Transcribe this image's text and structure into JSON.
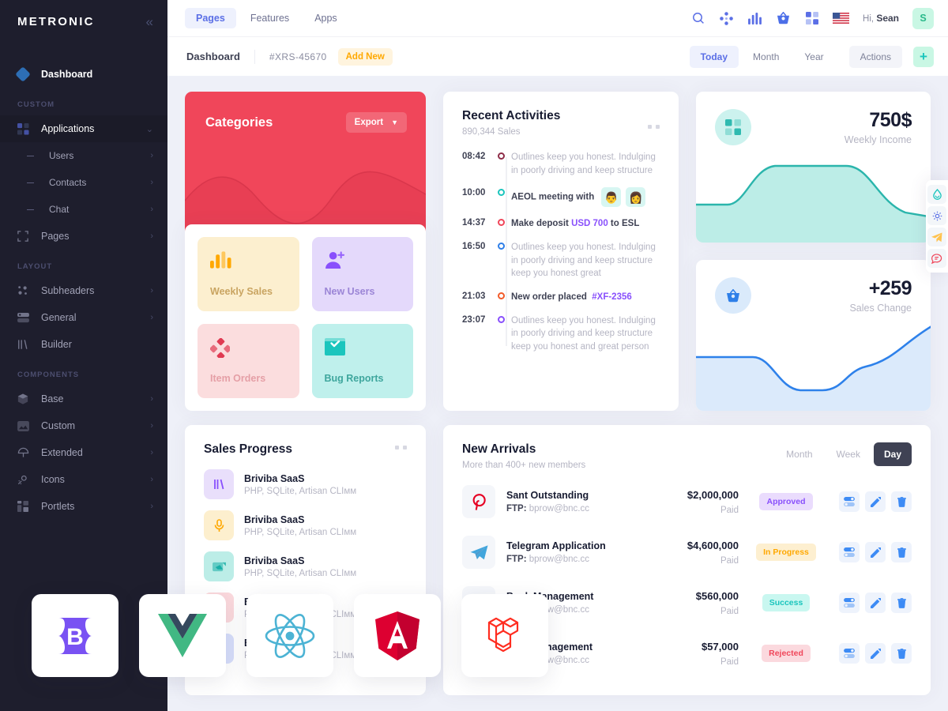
{
  "sidebar": {
    "brand": "METRONIC",
    "collapse_icon": "chevron-double-left-icon",
    "dashboard": {
      "label": "Dashboard",
      "icon": "diamond-icon"
    },
    "sections": [
      {
        "title": "CUSTOM",
        "items": [
          {
            "label": "Applications",
            "icon": "grid-icon",
            "arrow": "chevron-down",
            "active": true,
            "sub": false
          },
          {
            "label": "Users",
            "icon": "dash-icon",
            "arrow": "chevron-right",
            "sub": true
          },
          {
            "label": "Contacts",
            "icon": "dash-icon",
            "arrow": "chevron-right",
            "sub": true
          },
          {
            "label": "Chat",
            "icon": "dash-icon",
            "arrow": "chevron-right",
            "sub": true
          },
          {
            "label": "Pages",
            "icon": "frame-icon",
            "arrow": "chevron-right",
            "sub": false
          }
        ]
      },
      {
        "title": "LAYOUT",
        "items": [
          {
            "label": "Subheaders",
            "icon": "scatter-icon",
            "arrow": "chevron-right"
          },
          {
            "label": "General",
            "icon": "server-icon",
            "arrow": "chevron-right"
          },
          {
            "label": "Builder",
            "icon": "columns-icon",
            "arrow": ""
          }
        ]
      },
      {
        "title": "COMPONENTS",
        "items": [
          {
            "label": "Base",
            "icon": "box-icon",
            "arrow": "chevron-right"
          },
          {
            "label": "Custom",
            "icon": "image-icon",
            "arrow": "chevron-right"
          },
          {
            "label": "Extended",
            "icon": "umbrella-icon",
            "arrow": "chevron-right"
          },
          {
            "label": "Icons",
            "icon": "sparkle-icon",
            "arrow": "chevron-right"
          },
          {
            "label": "Portlets",
            "icon": "layout-icon",
            "arrow": "chevron-right"
          }
        ]
      }
    ]
  },
  "topbar": {
    "tabs": [
      {
        "label": "Pages",
        "active": true
      },
      {
        "label": "Features",
        "active": false
      },
      {
        "label": "Apps",
        "active": false
      }
    ],
    "icons": [
      "search-icon",
      "nodes-icon",
      "bar-chart-icon",
      "basket-icon",
      "grid-icon",
      "flag-us-icon"
    ],
    "greeting_prefix": "Hi,",
    "user_name": "Sean",
    "avatar_initial": "S"
  },
  "subheader": {
    "title": "Dashboard",
    "code": "#XRS-45670",
    "add_new": "Add New",
    "filters": [
      {
        "label": "Today",
        "active": true
      },
      {
        "label": "Month",
        "active": false
      },
      {
        "label": "Year",
        "active": false
      }
    ],
    "actions_label": "Actions",
    "plus_icon": "plus-file-icon"
  },
  "categories": {
    "title": "Categories",
    "export_label": "Export",
    "export_icon": "chevron-down-icon",
    "accent": "#F0465A",
    "tiles": [
      {
        "label": "Weekly Sales",
        "bg": "#FCEFCF",
        "fg": "#D9A85B",
        "icon": "bar-chart-icon",
        "icon_color": "#FFA800"
      },
      {
        "label": "New Users",
        "bg": "#E4D9FB",
        "fg": "#9B85D6",
        "icon": "user-plus-icon",
        "icon_color": "#8950FC"
      },
      {
        "label": "Item Orders",
        "bg": "#FBDDDE",
        "fg": "#DE9FA4",
        "icon": "diamonds-icon",
        "icon_color": "#F0465A"
      },
      {
        "label": "Bug Reports",
        "bg": "#BFF0EC",
        "fg": "#3EA69D",
        "icon": "mail-check-icon",
        "icon_color": "#1BC5BD"
      }
    ]
  },
  "activities": {
    "title": "Recent Activities",
    "subtitle": "890,344 Sales",
    "menu_icon": "more-dots-icon",
    "items": [
      {
        "time": "08:42",
        "dot": "#8E2D48",
        "strong": false,
        "text": "Outlines keep you honest. Indulging in poorly driving and keep structure"
      },
      {
        "time": "10:00",
        "dot": "#1BC5BD",
        "strong": true,
        "text": "AEOL meeting with",
        "avatars": [
          "avatar-man",
          "avatar-woman"
        ]
      },
      {
        "time": "14:37",
        "dot": "#F0465A",
        "strong": true,
        "text": "Make deposit ",
        "link": "USD 700",
        "link_color": "#8950FC",
        "text_after": " to ESL"
      },
      {
        "time": "16:50",
        "dot": "#2E7FE8",
        "strong": false,
        "text": "Outlines keep you honest. Indulging in poorly driving and keep structure keep you honest great"
      },
      {
        "time": "21:03",
        "dot": "#F25B2A",
        "strong": true,
        "text": "New order placed ",
        "link": "#XF-2356",
        "link_color": "#8950FC"
      },
      {
        "time": "23:07",
        "dot": "#8950FC",
        "strong": false,
        "text": "Outlines keep you honest. Indulging in poorly driving and keep structure keep you honest and great person"
      }
    ]
  },
  "stats": [
    {
      "value": "750$",
      "label": "Weekly Income",
      "icon": "grid-squares-icon",
      "icon_bg": "#CCF2EE",
      "icon_fg": "#43C6BC",
      "line_color": "#2BB5AC",
      "fill_color": "#BCEDE7"
    },
    {
      "value": "+259",
      "label": "Sales Change",
      "icon": "basket-icon",
      "icon_bg": "#DAEAFB",
      "icon_fg": "#2E7FE8",
      "line_color": "#2E81EA",
      "fill_color": "#DBEAFB"
    }
  ],
  "sales_progress": {
    "title": "Sales Progress",
    "menu_icon": "more-dots-icon",
    "rows": [
      {
        "name": "Briviba SaaS",
        "desc": "PHP, SQLite, Artisan CLIмм",
        "icon": "columns-icon",
        "bg": "#E9DFFB",
        "fg": "#8950FC"
      },
      {
        "name": "Briviba SaaS",
        "desc": "PHP, SQLite, Artisan CLIмм",
        "icon": "mic-icon",
        "bg": "#FDEFCE",
        "fg": "#FFA800"
      },
      {
        "name": "Briviba SaaS",
        "desc": "PHP, SQLite, Artisan CLIмм",
        "icon": "image-icon",
        "bg": "#BCEDE7",
        "fg": "#19AFA7"
      },
      {
        "name": "Briviba SaaS",
        "desc": "PHP, SQLite, Artisan CLIмм",
        "icon": "dot-icon",
        "bg": "#FBD9DD",
        "fg": "#F0465A"
      },
      {
        "name": "Briviba SaaS",
        "desc": "PHP, SQLite, Artisan CLIмм",
        "icon": "dot-icon",
        "bg": "#D7DEFB",
        "fg": "#5B6FE6"
      }
    ]
  },
  "new_arrivals": {
    "title": "New Arrivals",
    "subtitle": "More than 400+ new members",
    "tabs": [
      {
        "label": "Month",
        "active": false
      },
      {
        "label": "Week",
        "active": false
      },
      {
        "label": "Day",
        "active": true
      }
    ],
    "paid_label": "Paid",
    "ftp_label": "FTP:",
    "action_icons": [
      "toggle-icon",
      "edit-icon",
      "delete-icon"
    ],
    "rows": [
      {
        "logo": "pinterest-icon",
        "logo_color": "#E60023",
        "title": "Sant Outstanding",
        "ftp": "bprow@bnc.cc",
        "amount": "$2,000,000",
        "status": "Approved",
        "status_bg": "#EADCFD",
        "status_fg": "#8950FC"
      },
      {
        "logo": "telegram-icon",
        "logo_color": "#41A5DC",
        "title": "Telegram Application",
        "ftp": "bprow@bnc.cc",
        "amount": "$4,600,000",
        "status": "In Progress",
        "status_bg": "#FDEFD0",
        "status_fg": "#FFA800"
      },
      {
        "logo": "bootstrap-icon",
        "logo_color": "#7952F3",
        "title": "Bank Management",
        "ftp": "bprow@bnc.cc",
        "amount": "$560,000",
        "status": "Success",
        "status_bg": "#C9F7F0",
        "status_fg": "#1BC5BD"
      },
      {
        "logo": "vue-icon",
        "logo_color": "#41B883",
        "title": "Pixel Management",
        "ftp": "bprow@bnc.cc",
        "amount": "$57,000",
        "status": "Rejected",
        "status_bg": "#FBD9DE",
        "status_fg": "#F0465A"
      }
    ]
  },
  "fab_bar": {
    "buttons": [
      {
        "icon": "droplet-icon",
        "color": "#1BC5BD",
        "bg": "#F3F6F9"
      },
      {
        "icon": "gear-icon",
        "color": "#5B6FE6",
        "bg": "#F3F6F9"
      },
      {
        "icon": "send-icon",
        "color": "#FFA800",
        "bg": "#F3F6F9"
      },
      {
        "icon": "chat-icon",
        "color": "#F0465A",
        "bg": "#F3F6F9"
      }
    ]
  },
  "framework_logos": [
    {
      "name": "bootstrap-logo",
      "color": "#7952F3"
    },
    {
      "name": "vue-logo",
      "color": "#41B883"
    },
    {
      "name": "react-logo",
      "color": "#4CB3D4"
    },
    {
      "name": "angular-logo",
      "color": "#DD0031"
    },
    {
      "name": "laravel-logo",
      "color": "#FF2D20"
    }
  ]
}
